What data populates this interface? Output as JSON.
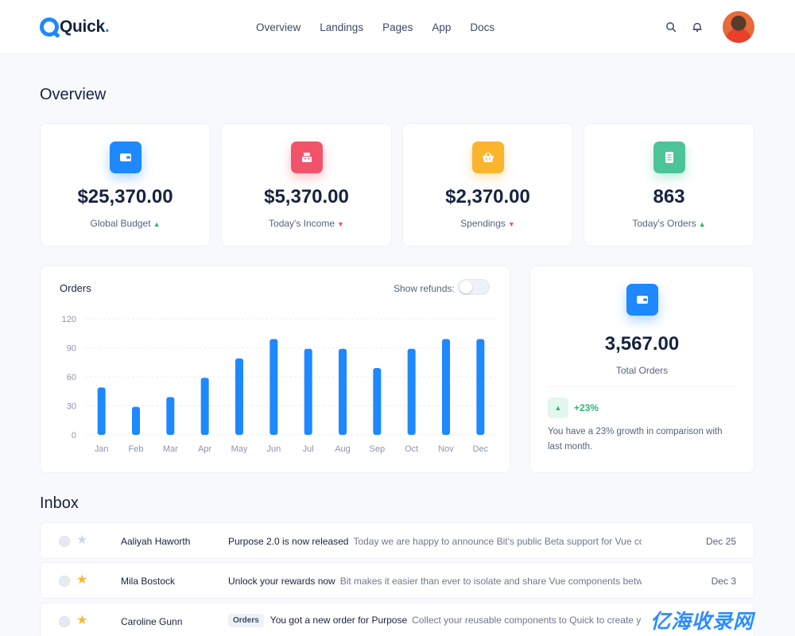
{
  "brand": {
    "name": "Quick",
    "dot": ".",
    "color": "#1e88ff"
  },
  "nav": {
    "items": [
      {
        "label": "Overview"
      },
      {
        "label": "Landings"
      },
      {
        "label": "Pages"
      },
      {
        "label": "App"
      },
      {
        "label": "Docs"
      }
    ],
    "icons": [
      "search-icon",
      "bell-icon"
    ]
  },
  "overview": {
    "title": "Overview",
    "stats": [
      {
        "value": "$25,370.00",
        "label": "Global Budget",
        "trend": "up",
        "icon": "wallet-icon",
        "color": "#1e88ff"
      },
      {
        "value": "$5,370.00",
        "label": "Today's Income",
        "trend": "down",
        "icon": "cash-register-icon",
        "color": "#f1546a"
      },
      {
        "value": "$2,370.00",
        "label": "Spendings",
        "trend": "down",
        "icon": "basket-icon",
        "color": "#fbb52c"
      },
      {
        "value": "863",
        "label": "Today's Orders",
        "trend": "up",
        "icon": "document-icon",
        "color": "#4cc497"
      }
    ]
  },
  "orders_card": {
    "title": "Orders",
    "refunds_label": "Show refunds:",
    "refunds_enabled": false
  },
  "chart_data": {
    "type": "bar",
    "title": "Orders",
    "categories": [
      "Jan",
      "Feb",
      "Mar",
      "Apr",
      "May",
      "Jun",
      "Jul",
      "Aug",
      "Sep",
      "Oct",
      "Nov",
      "Dec"
    ],
    "values": [
      49,
      29,
      39,
      59,
      79,
      99,
      89,
      89,
      69,
      89,
      99,
      99
    ],
    "ylim": [
      0,
      120
    ],
    "yticks": [
      0,
      30,
      60,
      90,
      120
    ],
    "grid": true,
    "color": "#1e88ff"
  },
  "total_card": {
    "value": "3,567.00",
    "label": "Total Orders",
    "growth": "+23%",
    "growth_text": "You have a 23% growth in comparison with last month.",
    "icon": "wallet-icon"
  },
  "inbox": {
    "title": "Inbox",
    "rows": [
      {
        "sender": "Aaliyah Haworth",
        "tag": "",
        "subject": "Purpose 2.0 is now released",
        "preview": "Today we are happy to announce Bit's public Beta support for Vue co...",
        "date": "Dec 25",
        "starred": false
      },
      {
        "sender": "Mila Bostock",
        "tag": "",
        "subject": "Unlock your rewards now",
        "preview": "Bit makes it easier than ever to isolate and share Vue components betw...",
        "date": "Dec 3",
        "starred": true
      },
      {
        "sender": "Caroline Gunn",
        "tag": "Orders",
        "subject": "You got a new order for Purpose",
        "preview": "Collect your reusable components to Quick to create your very",
        "date": "",
        "starred": true
      }
    ]
  },
  "watermark": "亿海收录网"
}
